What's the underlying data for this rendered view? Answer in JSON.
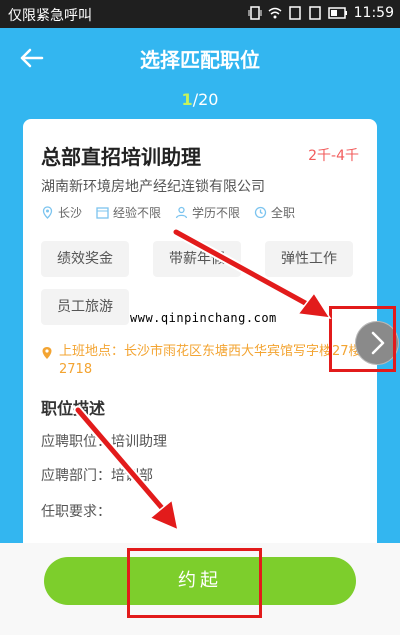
{
  "status_bar": {
    "left_text": "仅限紧急呼叫",
    "time": "11:59"
  },
  "header": {
    "title": "选择匹配职位",
    "back_icon": "arrow-left-icon"
  },
  "counter": {
    "current": "1",
    "total": "/20"
  },
  "job": {
    "title": "总部直招培训助理",
    "salary": "2千-4千",
    "company": "湖南新环境房地产经纪连锁有限公司",
    "meta": {
      "location": "长沙",
      "experience": "经验不限",
      "education": "学历不限",
      "type": "全职"
    },
    "tags": [
      "绩效奖金",
      "带薪年假",
      "弹性工作",
      "员工旅游"
    ],
    "address_label": "上班地点：",
    "address": "长沙市雨花区东塘西大华宾馆写字楼27楼2718",
    "desc_title": "职位描述",
    "position_label": "应聘职位：",
    "position_value": "培训助理",
    "department_label": "应聘部门：",
    "department_value": "培训部",
    "requirement_label": "任职要求："
  },
  "watermark": "www.qinpinchang.com",
  "cta": {
    "label": "约起"
  },
  "colors": {
    "background": "#33b6f0",
    "accent_green": "#7dce2c",
    "salary_red": "#f25c5c",
    "address_orange": "#f3a432",
    "annotation_red": "#e21b1b"
  }
}
